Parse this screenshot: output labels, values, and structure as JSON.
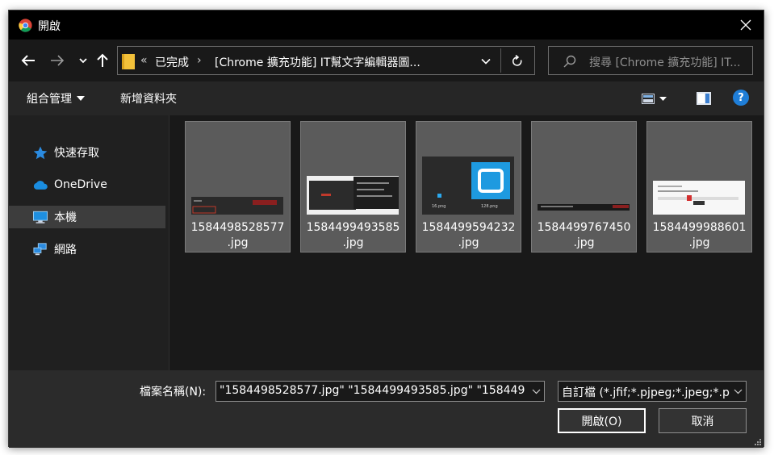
{
  "window": {
    "title": "開啟"
  },
  "address": {
    "crumbs": [
      "«",
      "已完成",
      "›",
      "[Chrome 擴充功能] IT幫文字編輯器圖..."
    ]
  },
  "search": {
    "placeholder": "搜尋 [Chrome 擴充功能] IT..."
  },
  "toolbar": {
    "organize_label": "組合管理",
    "new_folder_label": "新增資料夾"
  },
  "nav": {
    "items": [
      {
        "label": "快速存取",
        "icon": "star-icon"
      },
      {
        "label": "OneDrive",
        "icon": "cloud-icon"
      },
      {
        "label": "本機",
        "icon": "computer-icon",
        "selected": true
      },
      {
        "label": "網路",
        "icon": "network-icon"
      }
    ]
  },
  "files": [
    {
      "name_line1": "1584498528577",
      "name_line2": ".jpg"
    },
    {
      "name_line1": "1584499493585",
      "name_line2": ".jpg"
    },
    {
      "name_line1": "1584499594232",
      "name_line2": ".jpg"
    },
    {
      "name_line1": "1584499767450",
      "name_line2": ".jpg"
    },
    {
      "name_line1": "1584499988601",
      "name_line2": ".jpg"
    }
  ],
  "bottom": {
    "filename_label": "檔案名稱(N):",
    "filename_value": "\"1584498528577.jpg\" \"1584499493585.jpg\" \"158449­",
    "filetype_value": "自訂檔 (*.jfif;*.pjpeg;*.jpeg;*.p",
    "open_label": "開啟(O)",
    "cancel_label": "取消"
  },
  "thumb3_labels": [
    "16.png",
    "128.png"
  ],
  "colors": {
    "accent": "#1f7ed8",
    "background": "#202020",
    "folder": "#f3c13a"
  }
}
